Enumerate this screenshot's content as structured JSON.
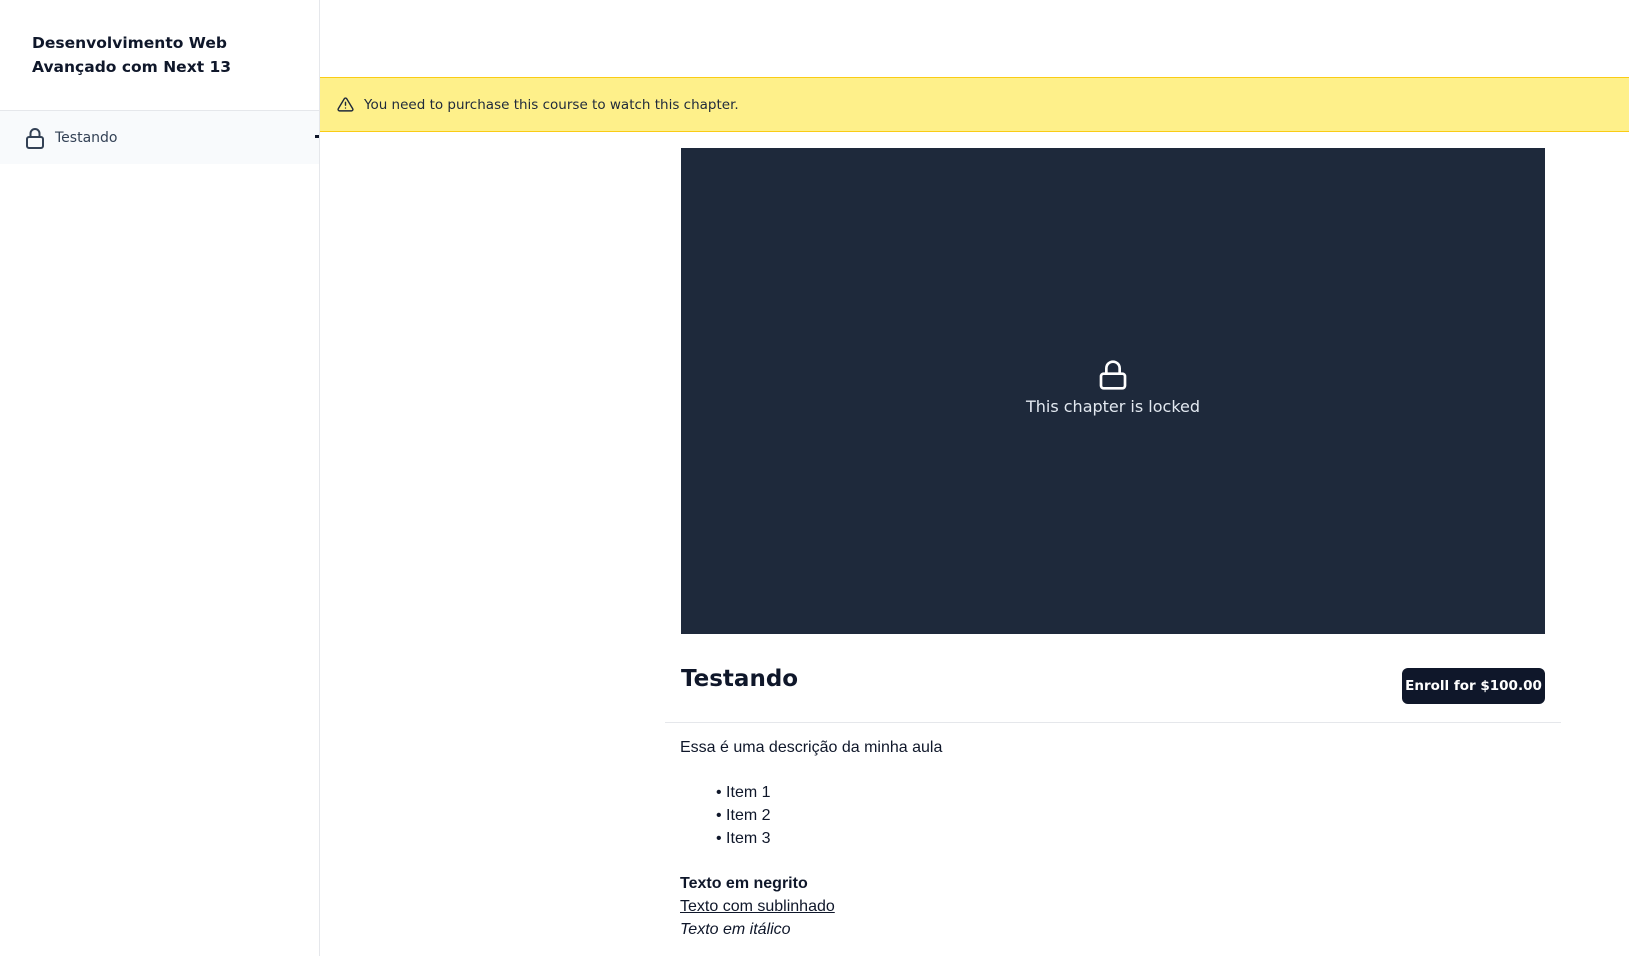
{
  "sidebar": {
    "course_title": "Desenvolvimento Web Avançado com Next 13",
    "chapters": [
      {
        "label": "Testando",
        "icon": "lock-icon",
        "locked": true,
        "active": true
      }
    ]
  },
  "banner": {
    "icon": "alert-triangle-icon",
    "text": "You need to purchase this course to watch this chapter."
  },
  "player": {
    "icon": "lock-icon",
    "locked_text": "This chapter is locked"
  },
  "chapter": {
    "title": "Testando",
    "enroll_label": "Enroll for $100.00"
  },
  "description": {
    "intro": "Essa é uma descrição da minha aula",
    "items": [
      "Item 1",
      "Item 2",
      "Item 3"
    ],
    "bold_text": "Texto em negrito",
    "underline_text": "Texto com sublinhado",
    "italic_text": "Texto em itálico"
  },
  "colors": {
    "banner_bg": "#fef08a",
    "player_bg": "#1e293b",
    "button_bg": "#0f172a"
  }
}
